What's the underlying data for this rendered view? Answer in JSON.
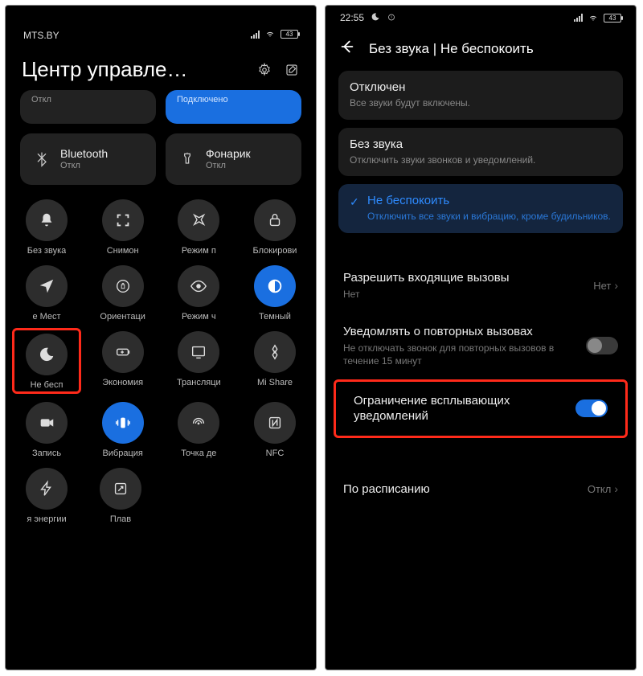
{
  "left": {
    "status": {
      "carrier": "MTS.BY",
      "battery": "43"
    },
    "title": "Центр управле…",
    "big_tiles": {
      "row0": {
        "left_sub": "Откл",
        "right_sub": "Подключено"
      },
      "row1": {
        "left": {
          "label": "Bluetooth",
          "sub": "Откл"
        },
        "right": {
          "label": "Фонарик",
          "sub": "Откл"
        }
      }
    },
    "toggles": {
      "row0": [
        {
          "label": "Без звука"
        },
        {
          "label": "Снимон"
        },
        {
          "label": "Режим п"
        },
        {
          "label": "Блокирови"
        }
      ],
      "row1": [
        {
          "label": "е   Мест"
        },
        {
          "label": "Ориентаци"
        },
        {
          "label": "Режим ч"
        },
        {
          "label": "Темный"
        }
      ],
      "row2": [
        {
          "label": "Не бесп"
        },
        {
          "label": "Экономия"
        },
        {
          "label": "Трансляци"
        },
        {
          "label": "Mi Share"
        }
      ],
      "row3": [
        {
          "label": "Запись"
        },
        {
          "label": "Вибрация"
        },
        {
          "label": "Точка де"
        },
        {
          "label": "NFC"
        }
      ],
      "row4": [
        {
          "label": "я энергии"
        },
        {
          "label": "Плав"
        }
      ]
    }
  },
  "right": {
    "status": {
      "time": "22:55",
      "battery": "43"
    },
    "header_title": "Без звука | Не беспокоить",
    "options": [
      {
        "title": "Отключен",
        "sub": "Все звуки будут включены."
      },
      {
        "title": "Без звука",
        "sub": "Отключить звуки звонков и уведомлений."
      },
      {
        "title": "Не беспокоить",
        "sub": "Отключить все звуки и вибрацию, кроме будильников."
      }
    ],
    "rows": {
      "allow_calls": {
        "label": "Разрешить входящие вызовы",
        "sub": "Нет",
        "value": "Нет"
      },
      "repeat": {
        "label": "Уведомлять о повторных вызовах",
        "sub": "Не отключать звонок для повторных вызовов в течение 15 минут"
      },
      "popup": {
        "label": "Ограничение всплывающих уведомлений"
      },
      "schedule": {
        "label": "По расписанию",
        "value": "Откл"
      }
    }
  }
}
